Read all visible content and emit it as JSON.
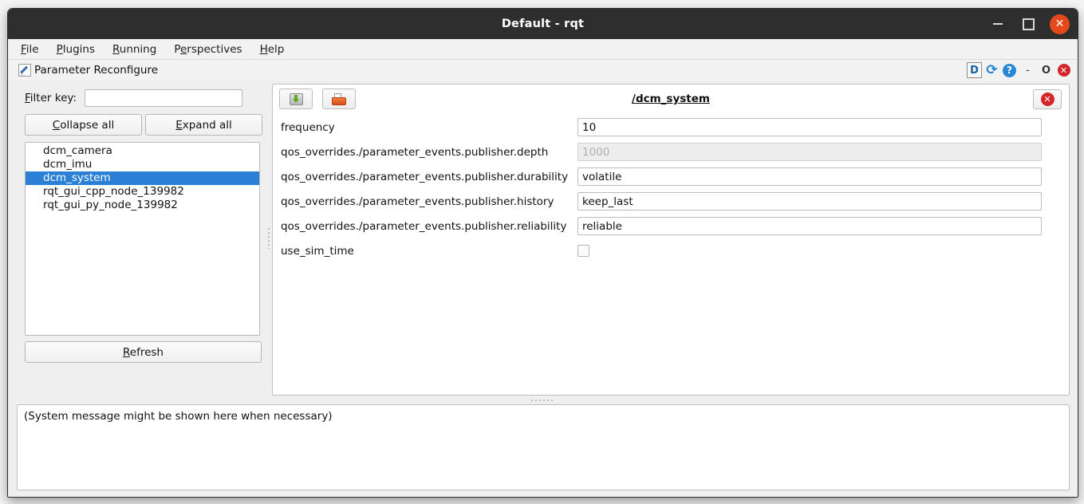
{
  "window": {
    "title": "Default - rqt",
    "minimize_label": "minimize",
    "maximize_label": "maximize",
    "close_label": "✕"
  },
  "menubar": {
    "items": [
      {
        "label": "File",
        "mnemonic": "F",
        "rest": "ile"
      },
      {
        "label": "Plugins",
        "mnemonic": "P",
        "rest": "lugins"
      },
      {
        "label": "Running",
        "mnemonic": "R",
        "rest": "unning"
      },
      {
        "label": "Perspectives",
        "pre": "P",
        "mnemonic": "e",
        "rest": "rspectives"
      },
      {
        "label": "Help",
        "mnemonic": "H",
        "rest": "elp"
      }
    ]
  },
  "plugin": {
    "title": "Parameter Reconfigure",
    "icon": "pencil-icon",
    "dock_controls": {
      "dockable": "D",
      "reload": "⟳",
      "help": "?",
      "dash": "-",
      "float": "O",
      "close": "✕"
    }
  },
  "sidebar": {
    "filter": {
      "label_pre": "F",
      "label_mnemonic": "",
      "label": "Filter key:",
      "value": "",
      "placeholder": ""
    },
    "collapse_button": "Collapse all",
    "expand_button": "Expand all",
    "refresh_button": "Refresh",
    "nodes": [
      {
        "label": "dcm_camera",
        "selected": false
      },
      {
        "label": "dcm_imu",
        "selected": false
      },
      {
        "label": "dcm_system",
        "selected": true
      },
      {
        "label": "rqt_gui_cpp_node_139982",
        "selected": false
      },
      {
        "label": "rqt_gui_py_node_139982",
        "selected": false
      }
    ]
  },
  "params_panel": {
    "save_icon": "save-icon",
    "open_icon": "folder-open-icon",
    "node_title": "/dcm_system",
    "close_button": "✕",
    "rows": [
      {
        "label": "frequency",
        "type": "text",
        "value": "10",
        "disabled": false
      },
      {
        "label": "qos_overrides./parameter_events.publisher.depth",
        "type": "text",
        "value": "1000",
        "disabled": true
      },
      {
        "label": "qos_overrides./parameter_events.publisher.durability",
        "type": "text",
        "value": "volatile",
        "disabled": false
      },
      {
        "label": "qos_overrides./parameter_events.publisher.history",
        "type": "text",
        "value": "keep_last",
        "disabled": false
      },
      {
        "label": "qos_overrides./parameter_events.publisher.reliability",
        "type": "text",
        "value": "reliable",
        "disabled": false
      },
      {
        "label": "use_sim_time",
        "type": "checkbox",
        "value": "",
        "checked": false,
        "disabled": false
      }
    ]
  },
  "console": {
    "message": "(System message might be shown here when necessary)"
  },
  "colors": {
    "titlebar_bg": "#2e2e2e",
    "close_orange": "#e4491c",
    "selection_blue": "#2b7fd4",
    "accent_red": "#d4262a",
    "save_green": "#5cab22",
    "folder_orange": "#e0611f",
    "panel_bg": "#efefef"
  }
}
